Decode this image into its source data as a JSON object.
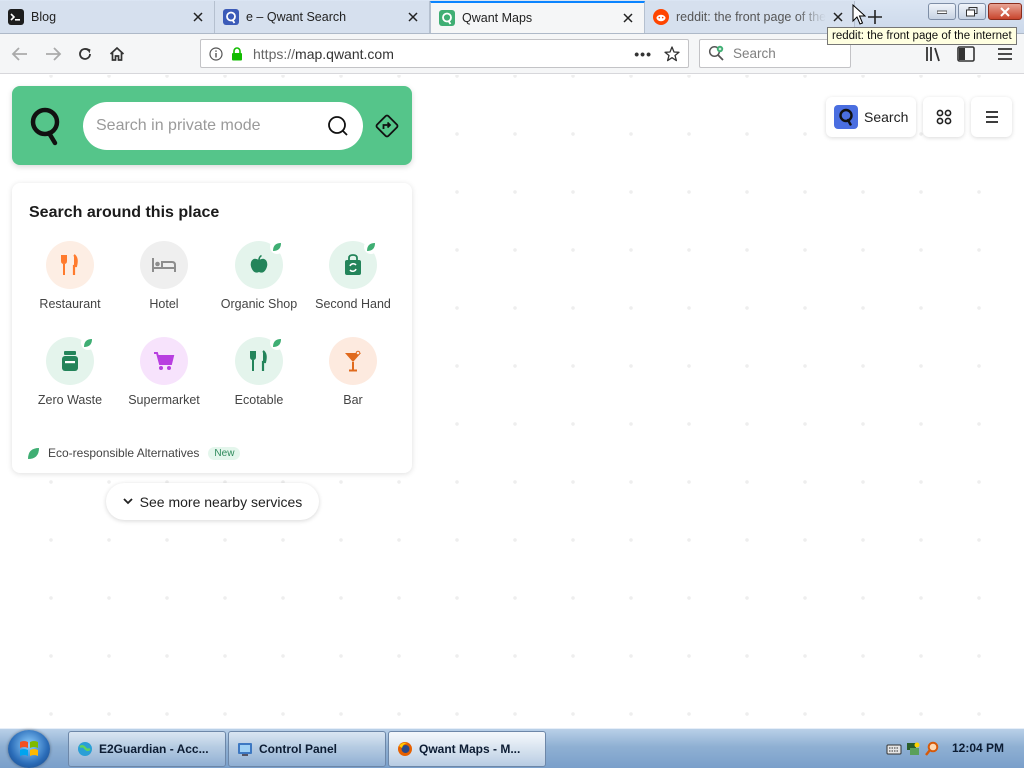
{
  "browser": {
    "tabs": [
      {
        "title": "Blog",
        "favicon": "terminal-favicon",
        "active": false
      },
      {
        "title": "e – Qwant Search",
        "favicon": "qwant-q-favicon",
        "active": false
      },
      {
        "title": "Qwant Maps",
        "favicon": "qwant-maps-favicon",
        "active": true
      },
      {
        "title": "reddit: the front page of the internet",
        "favicon": "reddit-favicon",
        "active": false
      }
    ],
    "tooltip": "reddit: the front page of the internet",
    "url": {
      "prefix": "https://",
      "host": "map.qwant.com"
    },
    "search_placeholder": "Search"
  },
  "map": {
    "search_placeholder": "Search in private mode",
    "around_title": "Search around this place",
    "categories": [
      {
        "label": "Restaurant",
        "icon": "fork-knife-icon",
        "eco": false,
        "color": "#ff7b2e",
        "bg": "#fdeee4"
      },
      {
        "label": "Hotel",
        "icon": "bed-icon",
        "eco": false,
        "color": "#8d8d8d",
        "bg": "#efefef"
      },
      {
        "label": "Organic Shop",
        "icon": "apple-icon",
        "eco": true,
        "color": "#23845a",
        "bg": "#e4f4ec"
      },
      {
        "label": "Second Hand",
        "icon": "recycle-bag-icon",
        "eco": true,
        "color": "#23845a",
        "bg": "#e4f4ec"
      },
      {
        "label": "Zero Waste",
        "icon": "jar-icon",
        "eco": true,
        "color": "#23845a",
        "bg": "#e4f4ec"
      },
      {
        "label": "Supermarket",
        "icon": "cart-icon",
        "eco": false,
        "color": "#b83ee0",
        "bg": "#f7e3fc"
      },
      {
        "label": "Ecotable",
        "icon": "fork-knife-icon",
        "eco": true,
        "color": "#23845a",
        "bg": "#e4f4ec"
      },
      {
        "label": "Bar",
        "icon": "cocktail-icon",
        "eco": false,
        "color": "#e06a1d",
        "bg": "#fdeadf"
      }
    ],
    "eco_label": "Eco-responsible Alternatives",
    "eco_badge": "New",
    "more_label": "See more nearby services",
    "top_search_label": "Search"
  },
  "taskbar": {
    "items": [
      {
        "label": "E2Guardian - Acc...",
        "icon": "globe-icon",
        "active": false
      },
      {
        "label": "Control Panel",
        "icon": "control-panel-icon",
        "active": false
      },
      {
        "label": "Qwant Maps - M...",
        "icon": "firefox-icon",
        "active": true
      }
    ],
    "clock": "12:04 PM"
  },
  "colors": {
    "brand_green": "#55c58a",
    "brand_blue": "#4a6ee0",
    "accent_tab": "#0a84ff"
  }
}
